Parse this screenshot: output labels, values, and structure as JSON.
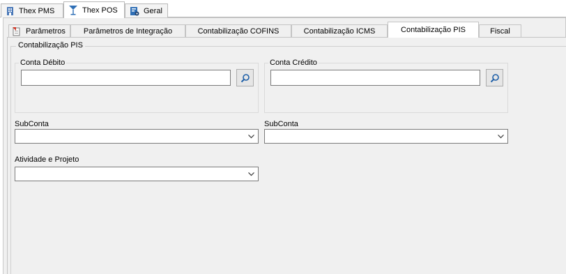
{
  "top_tabs": [
    {
      "label": "Thex PMS",
      "icon": "building-icon"
    },
    {
      "label": "Thex POS",
      "icon": "cocktail-glass-icon"
    },
    {
      "label": "Geral",
      "icon": "settings-document-icon"
    }
  ],
  "inner_tabs": [
    {
      "label": "Parâmetros",
      "icon": "parameters-icon"
    },
    {
      "label": "Parâmetros de Integração"
    },
    {
      "label": "Contabilização COFINS"
    },
    {
      "label": "Contabilização ICMS"
    },
    {
      "label": "Contabilização PIS"
    },
    {
      "label": "Fiscal"
    }
  ],
  "group": {
    "title": "Contabilização PIS",
    "conta_debito": {
      "label": "Conta Débito",
      "value": ""
    },
    "conta_credito": {
      "label": "Conta Crédito",
      "value": ""
    },
    "subconta_debito": {
      "label": "SubConta",
      "value": ""
    },
    "subconta_credito": {
      "label": "SubConta",
      "value": ""
    },
    "atividade_projeto": {
      "label": "Atividade e Projeto",
      "value": ""
    }
  },
  "colors": {
    "accent": "#1e5fa8",
    "frame_bg": "#f0f0f0",
    "border": "#7a7a7a"
  }
}
